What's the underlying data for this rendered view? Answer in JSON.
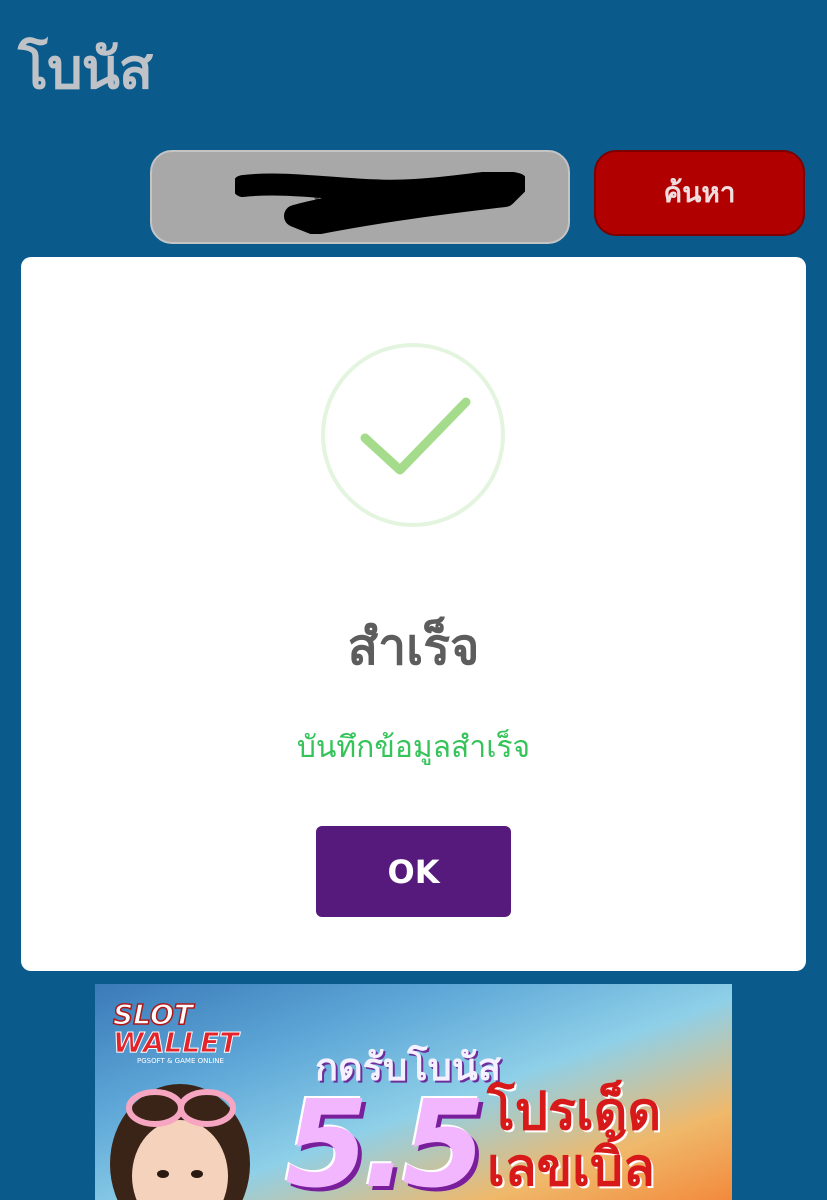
{
  "header": {
    "title": "โบนัส"
  },
  "search": {
    "value": "VI KS...",
    "button_label": "ค้นหา"
  },
  "banner": {
    "logo_text": "SLOT WALLET",
    "logo_sub": "PGSOFT & GAME ONLINE",
    "headline": "กดรับโบนัส",
    "big_text": "5.5",
    "promo_line1": "โปรเด็ด",
    "promo_line2": "เลขเบิ้ล"
  },
  "modal": {
    "title": "สำเร็จ",
    "message": "บันทึกข้อมูลสำเร็จ",
    "ok_label": "OK"
  },
  "colors": {
    "background": "#0a5a8c",
    "search_button": "#b10000",
    "success_green": "#35c35a",
    "ok_button": "#561a7c"
  }
}
